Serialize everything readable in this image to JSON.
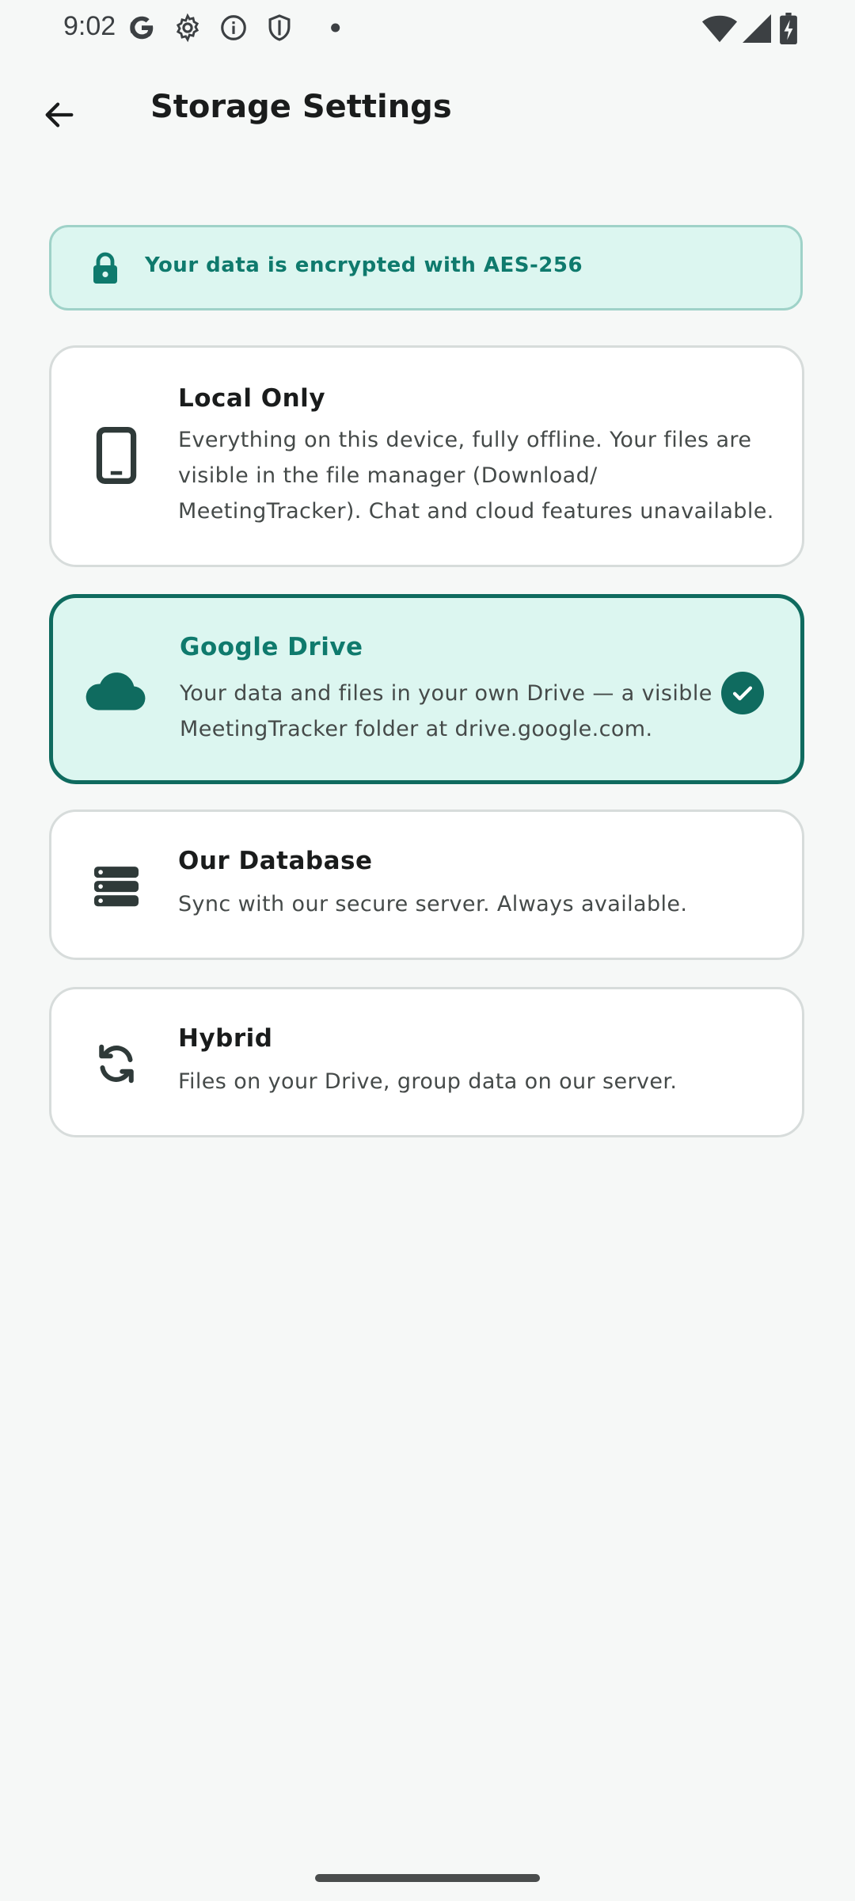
{
  "status_bar": {
    "time": "9:02",
    "icons": [
      "google-icon",
      "settings-gear-icon",
      "info-icon",
      "shield-icon",
      "dot-icon"
    ],
    "right_icons": [
      "wifi-icon",
      "cell-signal-icon",
      "battery-charging-icon"
    ]
  },
  "app_bar": {
    "title": "Storage Settings",
    "back_icon": "arrow-left-icon"
  },
  "banner": {
    "icon": "lock-icon",
    "text": "Your data is encrypted with AES-256",
    "bg_color": "#dcf6f0",
    "text_color": "#0f7a6d"
  },
  "options": [
    {
      "icon": "smartphone-icon",
      "title": "Local Only",
      "description_lines": [
        "Everything on this device, fully offline. Your files are",
        "visible in the file manager (Download/",
        "MeetingTracker). Chat and cloud features unavailable."
      ],
      "selected": false
    },
    {
      "icon": "cloud-icon",
      "title": "Google Drive",
      "description_lines": [
        "Your data and files in your own Drive — a visible",
        "MeetingTracker folder at drive.google.com."
      ],
      "selected": true
    },
    {
      "icon": "database-icon",
      "title": "Our Database",
      "description_lines": [
        "Sync with our secure server. Always available."
      ],
      "selected": false
    },
    {
      "icon": "sync-icon",
      "title": "Hybrid",
      "description_lines": [
        "Files on your Drive, group data on our server."
      ],
      "selected": false
    }
  ],
  "accent_color": "#0f6b5f"
}
